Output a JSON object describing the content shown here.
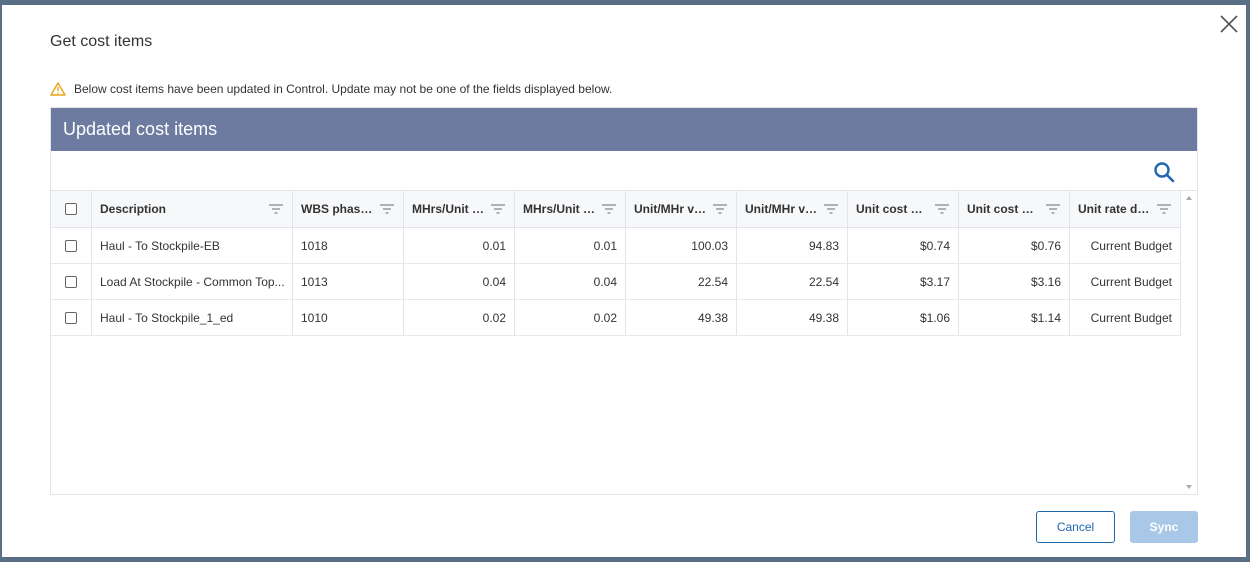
{
  "dialog": {
    "title": "Get cost items",
    "warning": "Below cost items have been updated in Control. Update may not be one of the fields displayed below."
  },
  "grid": {
    "header": "Updated cost items",
    "columns": [
      "Description",
      "WBS phase ...",
      "MHrs/Unit v...",
      "MHrs/Unit v...",
      "Unit/MHr va...",
      "Unit/MHr va...",
      "Unit cost va...",
      "Unit cost va...",
      "Unit rate dri..."
    ],
    "rows": [
      [
        "Haul  - To Stockpile-EB",
        "1018",
        "0.01",
        "0.01",
        "100.03",
        "94.83",
        "$0.74",
        "$0.76",
        "Current Budget"
      ],
      [
        "Load At Stockpile - Common Top...",
        "1013",
        "0.04",
        "0.04",
        "22.54",
        "22.54",
        "$3.17",
        "$3.16",
        "Current Budget"
      ],
      [
        "Haul  - To Stockpile_1_ed",
        "1010",
        "0.02",
        "0.02",
        "49.38",
        "49.38",
        "$1.06",
        "$1.14",
        "Current Budget"
      ]
    ]
  },
  "buttons": {
    "cancel": "Cancel",
    "sync": "Sync"
  },
  "colors": {
    "header_bg": "#6e7ba0",
    "primary": "#2266b0",
    "warning": "#e8a317",
    "sync_disabled": "#a9c7e6"
  }
}
